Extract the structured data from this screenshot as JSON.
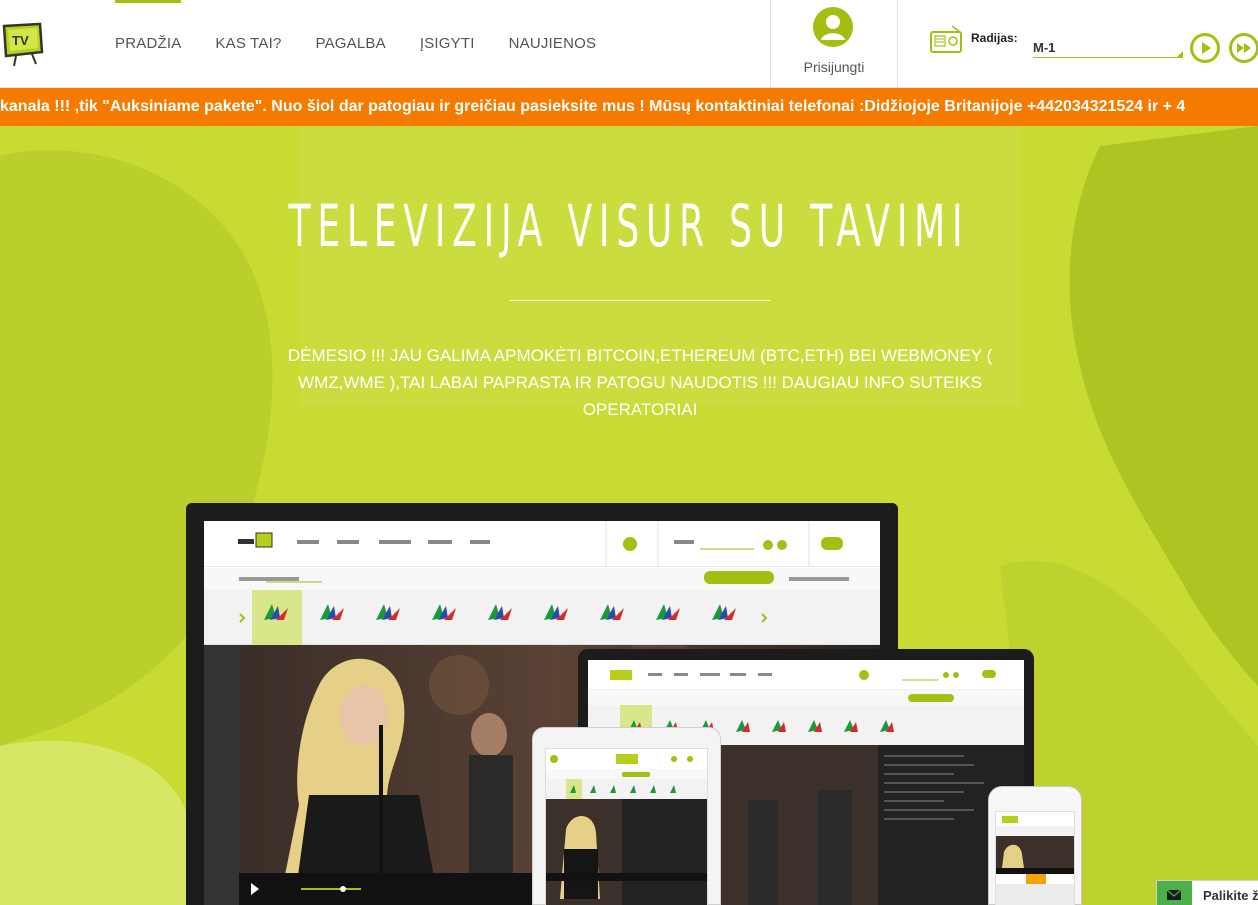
{
  "header": {
    "logo_text": "TV",
    "nav": [
      {
        "label": "PRADŽIA",
        "active": true
      },
      {
        "label": "KAS TAI?"
      },
      {
        "label": "PAGALBA"
      },
      {
        "label": "ĮSIGYTI"
      },
      {
        "label": "NAUJIENOS"
      }
    ],
    "login_label": "Prisijungti",
    "radio_label": "Radijas:",
    "radio_station": "M-1"
  },
  "ticker": {
    "text": "kanala !!! ,tik \"Auksiniame pakete\". Nuo šiol dar patogiau ir greičiau pasieksite mus !  Mūsų kontaktiniai telefonai :Didžiojoje Britanijoje  +442034321524  ir  + 4"
  },
  "hero": {
    "title": "TELEVIZIJA VISUR SU TAVIMI",
    "message": "DĖMESIO !!! JAU GALIMA APMOKĖTI BITCOIN,ETHEREUM (BTC,ETH) BEI WEBMONEY ( WMZ,WME ),TAI LABAI PAPRASTA IR PATOGU NAUDOTIS !!! DAUGIAU INFO SUTEIKS OPERATORIAI"
  },
  "chat": {
    "label": "Palikite ž"
  },
  "colors": {
    "accent": "#a6bd12",
    "ticker": "#f47b00",
    "hero": "#c8dc32",
    "chat_green": "#4db04a"
  },
  "icons": [
    "tv-logo-icon",
    "user-avatar-icon",
    "radio-icon",
    "play-icon",
    "fast-forward-icon",
    "mail-icon"
  ]
}
